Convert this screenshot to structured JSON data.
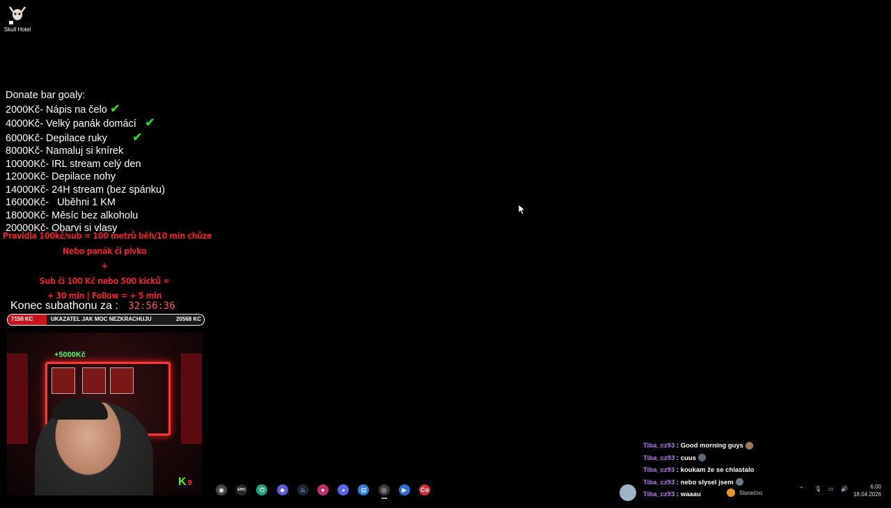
{
  "desktop": {
    "icon_label": "Skull Hotel"
  },
  "goals": {
    "heading": "Donate bar goaly:",
    "items": [
      {
        "amount": "2000Kč",
        "text": "Nápis na čelo",
        "done": true
      },
      {
        "amount": "4000Kč",
        "text": "Velký panák domácí",
        "done": true
      },
      {
        "amount": "6000Kč",
        "text": "Depilace ruky",
        "done": true
      },
      {
        "amount": "8000Kč",
        "text": "Namaluj si knírek",
        "done": false
      },
      {
        "amount": "10000Kč",
        "text": "IRL stream celý den",
        "done": false
      },
      {
        "amount": "12000Kč",
        "text": "Depilace nohy",
        "done": false
      },
      {
        "amount": "14000Kč",
        "text": "24H stream (bez spánku)",
        "done": false
      },
      {
        "amount": "16000Kč",
        "text": "  Uběhni 1 KM",
        "done": false
      },
      {
        "amount": "18000Kč",
        "text": "Měsíc bez alkoholu",
        "done": false
      },
      {
        "amount": "20000Kč",
        "text": "Obarvi si vlasy",
        "done": false
      }
    ],
    "check_glyph": "✔",
    "separator": "- "
  },
  "rules": {
    "line1": "Pravidla 100kč/sub = 100 metrů běh/10 min chůze",
    "line2": "Nebo panák či pivko",
    "line3": "+",
    "line4": "Sub či 100 Kč nebo 500 kicků =",
    "line5": "+ 30 min | Follow = + 5 min"
  },
  "subathon": {
    "label": "Konec subathonu za :",
    "countdown": "32:56:36"
  },
  "meter": {
    "left_value": "7150 KC",
    "center_label": "UKAZATEL JAK MOC NEZKRACHUJU",
    "right_value": "20568 KC",
    "fill_fraction": 0.2
  },
  "webcam": {
    "overlay_label": "+5000Kč",
    "kick_logo": "K",
    "kick_count": "9"
  },
  "taskbar": {
    "icons": [
      {
        "name": "chrome-icon",
        "color": "#444",
        "glyph": "◉"
      },
      {
        "name": "epic-games-icon",
        "color": "#2a2a2a",
        "glyph": "EPIC"
      },
      {
        "name": "power-app-icon",
        "color": "#1fa37a",
        "glyph": "⏻"
      },
      {
        "name": "diamond-app-icon",
        "color": "#5b5bd6",
        "glyph": "◆"
      },
      {
        "name": "steam-icon",
        "color": "#1b2838",
        "glyph": "♨"
      },
      {
        "name": "location-app-icon",
        "color": "#c0306a",
        "glyph": "●"
      },
      {
        "name": "discord-icon",
        "color": "#5865f2",
        "glyph": "◕"
      },
      {
        "name": "notepad-icon",
        "color": "#2f7fd6",
        "glyph": "▤"
      },
      {
        "name": "obs-icon",
        "color": "#3a3a3a",
        "glyph": "◎"
      },
      {
        "name": "streamer-app-icon",
        "color": "#2f6fd6",
        "glyph": "▶"
      },
      {
        "name": "rec-app-icon",
        "color": "#d0303a",
        "glyph": "Co"
      }
    ],
    "weather": "Slunečno",
    "time": "6:00",
    "date": "18.04.2026"
  },
  "chat": [
    {
      "user": "Tiba_cz93",
      "message": "Good morning guys",
      "emote_color": "#9a7a5a"
    },
    {
      "user": "Tiba_cz93",
      "message": "cuus",
      "emote_color": "#5a6a7a"
    },
    {
      "user": "Tiba_cz93",
      "message": "koukam že se chlastalo",
      "emote_color": ""
    },
    {
      "user": "Tiba_cz93",
      "message": "nebo slysel jsem",
      "emote_color": "#6a7a8a"
    },
    {
      "user": "Tiba_cz93",
      "message": "waaau",
      "emote_color": ""
    }
  ]
}
